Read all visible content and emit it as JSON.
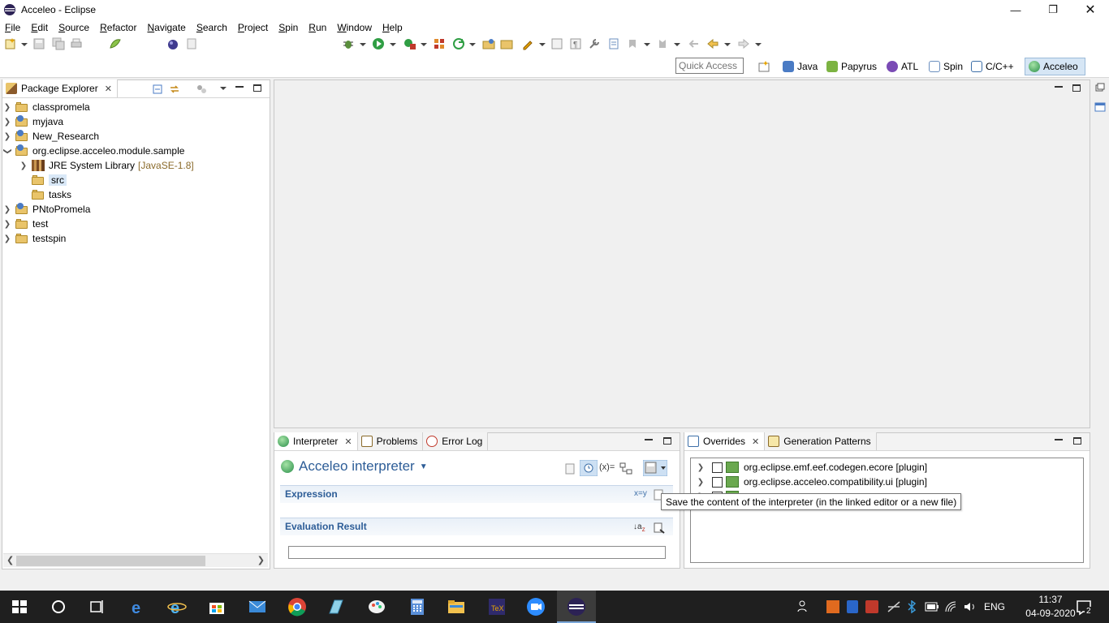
{
  "window": {
    "title": "Acceleo - Eclipse"
  },
  "menu": [
    "File",
    "Edit",
    "Source",
    "Refactor",
    "Navigate",
    "Search",
    "Project",
    "Spin",
    "Run",
    "Window",
    "Help"
  ],
  "quick_access": {
    "placeholder": "Quick Access"
  },
  "perspectives": [
    {
      "label": "Java",
      "icon": "java-perspective-icon",
      "color": "#4a7bc4"
    },
    {
      "label": "Papyrus",
      "icon": "papyrus-perspective-icon",
      "color": "#7cb342"
    },
    {
      "label": "ATL",
      "icon": "atl-perspective-icon",
      "color": "#7a4bb5"
    },
    {
      "label": "Spin",
      "icon": "spin-perspective-icon",
      "color": "#6b8fbf"
    },
    {
      "label": "C/C++",
      "icon": "cpp-perspective-icon",
      "color": "#3d6fa8"
    },
    {
      "label": "Acceleo",
      "icon": "acceleo-perspective-icon",
      "color": "#2a8f4a"
    }
  ],
  "package_explorer": {
    "tab_label": "Package Explorer",
    "items": [
      {
        "label": "classpromela",
        "expanded": false
      },
      {
        "label": "myjava",
        "expanded": false
      },
      {
        "label": "New_Research",
        "expanded": false
      },
      {
        "label": "org.eclipse.acceleo.module.sample",
        "expanded": true
      },
      {
        "label": "JRE System Library",
        "decoration": "[JavaSE-1.8]"
      },
      {
        "label": "src"
      },
      {
        "label": "tasks"
      },
      {
        "label": "PNtoPromela",
        "expanded": false
      },
      {
        "label": "test",
        "expanded": false
      },
      {
        "label": "testspin",
        "expanded": false
      }
    ]
  },
  "bottom_left": {
    "tabs": [
      "Interpreter",
      "Problems",
      "Error Log"
    ],
    "interpreter_title": "Acceleo interpreter",
    "expression_label": "Expression",
    "evaluation_label": "Evaluation Result"
  },
  "tooltip": "Save the content of the interpreter (in the linked editor or a new file)",
  "bottom_right": {
    "tabs": [
      "Overrides",
      "Generation Patterns"
    ],
    "rows": [
      "org.eclipse.emf.eef.codegen.ecore [plugin]",
      "org.eclipse.acceleo.compatibility.ui [plugin]"
    ]
  },
  "taskbar": {
    "language": "ENG",
    "time": "11:37",
    "date": "04-09-2020",
    "notification_count": "2"
  },
  "colors": {
    "accent": "#2d5d97",
    "taskbar": "#1f1f1f"
  }
}
